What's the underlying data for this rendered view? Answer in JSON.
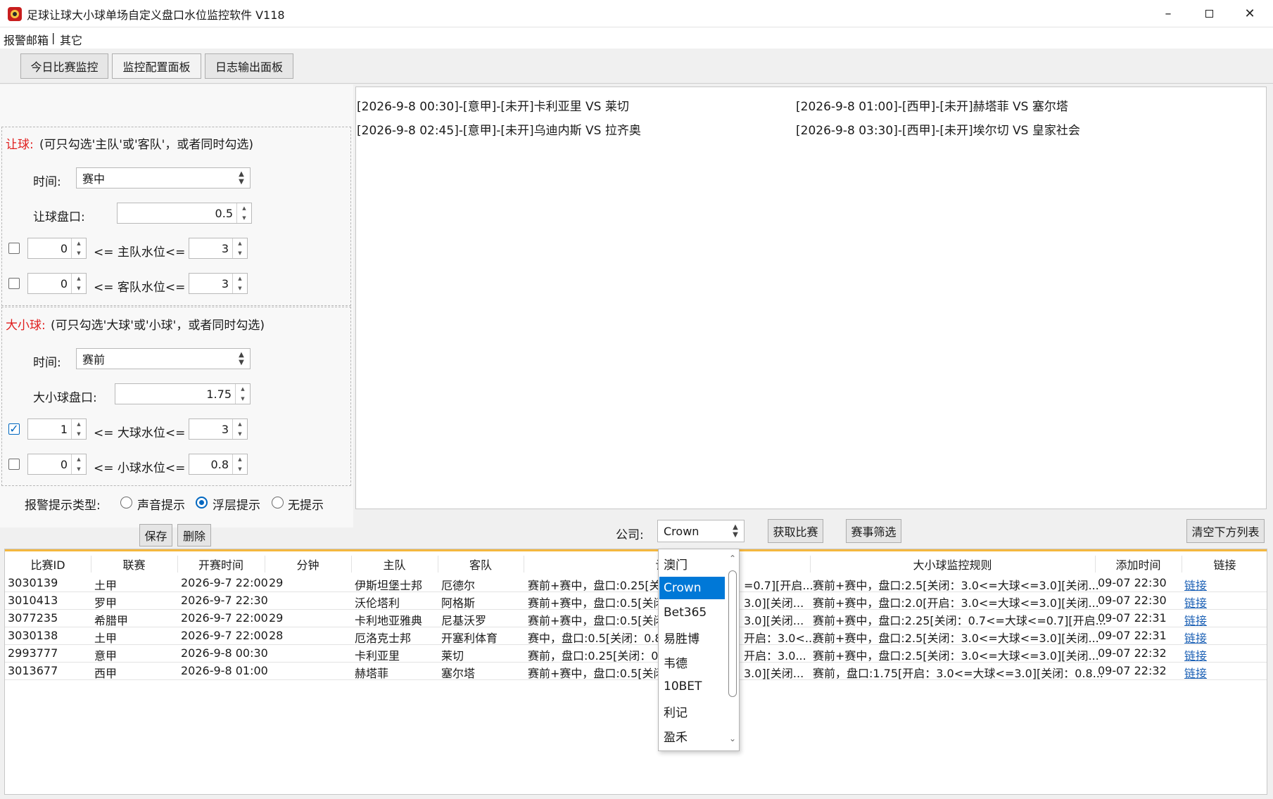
{
  "window": {
    "title": "足球让球大小球单场自定义盘口水位监控软件 V118"
  },
  "menu": [
    "报警邮箱",
    "|",
    "其它"
  ],
  "tabs": [
    "今日比赛监控",
    "监控配置面板",
    "日志输出面板"
  ],
  "handicap": {
    "title": "让球:",
    "hint": "(可只勾选'主队'或'客队'，或者同时勾选)",
    "time_label": "时间:",
    "time_value": "赛中",
    "line_label": "让球盘口:",
    "line_value": "0.5",
    "home": {
      "checked": false,
      "min": "0",
      "label": "<= 主队水位<=",
      "max": "3"
    },
    "away": {
      "checked": false,
      "min": "0",
      "label": "<= 客队水位<=",
      "max": "3"
    }
  },
  "overunder": {
    "title": "大小球:",
    "hint": "(可只勾选'大球'或'小球'，或者同时勾选)",
    "time_label": "时间:",
    "time_value": "赛前",
    "line_label": "大小球盘口:",
    "line_value": "1.75",
    "over": {
      "checked": true,
      "min": "1",
      "label": "<= 大球水位<=",
      "max": "3"
    },
    "under": {
      "checked": false,
      "min": "0",
      "label": "<= 小球水位<=",
      "max": "0.8"
    }
  },
  "alert": {
    "label": "报警提示类型:",
    "options": [
      "声音提示",
      "浮层提示",
      "无提示"
    ],
    "selected": 1
  },
  "buttons": {
    "save": "保存",
    "delete": "删除",
    "fetch": "获取比赛",
    "filter": "赛事筛选",
    "clear": "清空下方列表"
  },
  "company": {
    "label": "公司:",
    "value": "Crown",
    "options": [
      "澳门",
      "Crown",
      "Bet365",
      "易胜博",
      "韦德",
      "10BET",
      "利记",
      "盈禾"
    ],
    "selected": 1
  },
  "log_lines": [
    "[2026-9-8 00:30]-[意甲]-[未开]卡利亚里 VS 莱切",
    "[2026-9-8 01:00]-[西甲]-[未开]赫塔菲 VS 塞尔塔",
    "[2026-9-8 02:45]-[意甲]-[未开]乌迪内斯 VS 拉齐奥",
    "[2026-9-8 03:30]-[西甲]-[未开]埃尔切 VS 皇家社会"
  ],
  "table": {
    "headers": [
      "比赛ID",
      "联赛",
      "开赛时间",
      "分钟",
      "主队",
      "客队",
      "让球",
      "大小球监控规则",
      "添加时间",
      "链接"
    ],
    "rows": [
      {
        "id": "3030139",
        "league": "土甲",
        "time": "2026-9-7 22:00",
        "minute": "29",
        "home": "伊斯坦堡士邦",
        "away": "厄德尔",
        "rule1": "赛前+赛中，盘口:0.25[关",
        "rule1b": "=0.7][开启...",
        "rule2": "赛前+赛中，盘口:2.5[关闭：3.0<=大球<=3.0][关闭...",
        "added": "09-07 22:30",
        "link": "链接"
      },
      {
        "id": "3010413",
        "league": "罗甲",
        "time": "2026-9-7 22:30",
        "minute": "",
        "home": "沃伦塔利",
        "away": "阿格斯",
        "rule1": "赛前+赛中，盘口:0.5[关闭",
        "rule1b": "3.0][关闭...",
        "rule2": "赛前+赛中，盘口:2.0[开启：3.0<=大球<=3.0][关闭...",
        "added": "09-07 22:30",
        "link": "链接"
      },
      {
        "id": "3077235",
        "league": "希腊甲",
        "time": "2026-9-7 22:00",
        "minute": "29",
        "home": "卡利地亚雅典",
        "away": "尼基沃罗",
        "rule1": "赛前+赛中，盘口:0.5[关闭",
        "rule1b": "3.0][关闭...",
        "rule2": "赛前+赛中，盘口:2.25[关闭：0.7<=大球<=0.7][开启...",
        "added": "09-07 22:31",
        "link": "链接"
      },
      {
        "id": "3030138",
        "league": "土甲",
        "time": "2026-9-7 22:00",
        "minute": "28",
        "home": "厄洛克士邦",
        "away": "开塞利体育",
        "rule1": "赛中，盘口:0.5[关闭：0.8",
        "rule1b": "开启：3.0<...",
        "rule2": "赛前+赛中，盘口:2.5[关闭：3.0<=大球<=3.0][关闭...",
        "added": "09-07 22:31",
        "link": "链接"
      },
      {
        "id": "2993777",
        "league": "意甲",
        "time": "2026-9-8 00:30",
        "minute": "",
        "home": "卡利亚里",
        "away": "莱切",
        "rule1": "赛前，盘口:0.25[关闭：0.",
        "rule1b": "开启：3.0...",
        "rule2": "赛前+赛中，盘口:2.5[关闭：3.0<=大球<=3.0][关闭...",
        "added": "09-07 22:32",
        "link": "链接"
      },
      {
        "id": "3013677",
        "league": "西甲",
        "time": "2026-9-8 01:00",
        "minute": "",
        "home": "赫塔菲",
        "away": "塞尔塔",
        "rule1": "赛前+赛中，盘口:0.5[关闭",
        "rule1b": "3.0][关闭...",
        "rule2": "赛前，盘口:1.75[开启：3.0<=大球<=3.0][关闭：0.8...",
        "added": "09-07 22:32",
        "link": "链接"
      }
    ]
  }
}
